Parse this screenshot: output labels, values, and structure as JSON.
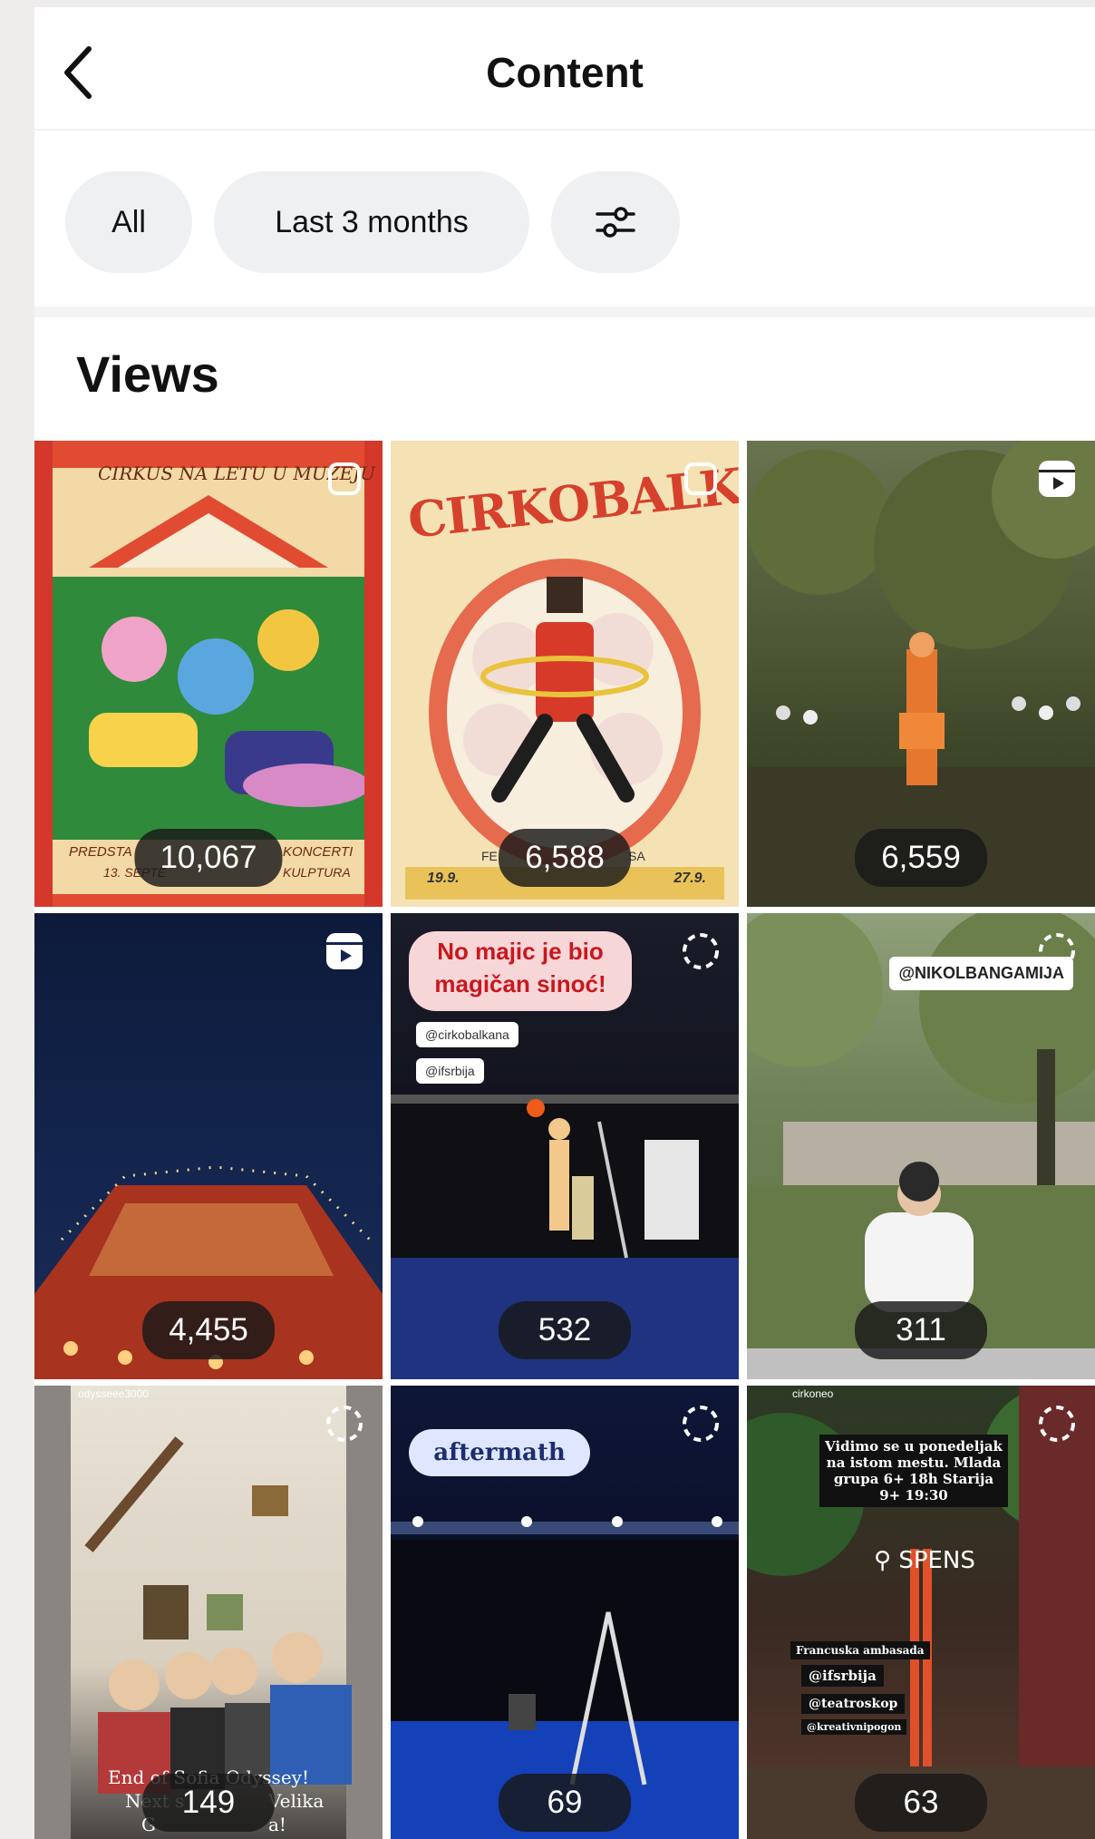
{
  "header": {
    "title": "Content"
  },
  "filters": {
    "all_label": "All",
    "range_label": "Last 3 months"
  },
  "section": {
    "title": "Views"
  },
  "colors": {
    "badge_bg": "#1c1c1c",
    "chip_bg": "#eef0f2",
    "accent_red": "#e14b32"
  },
  "tiles": [
    {
      "views": "10,067",
      "type_icon": "post-icon",
      "text1": "CIRKUS NA LETU U MUZEJU",
      "text2": "PREDSTA",
      "text3": "13. SEPTE",
      "text4": "KONCERTI",
      "text5": "KULPTURA"
    },
    {
      "views": "6,588",
      "type_icon": "post-icon",
      "text1": "CIRKOBALKANA",
      "text2": "19.9.",
      "text3": "27.9.",
      "text4": "FE",
      "text5": "SA"
    },
    {
      "views": "6,559",
      "type_icon": "reel-icon"
    },
    {
      "views": "4,455",
      "type_icon": "reel-icon"
    },
    {
      "views": "532",
      "type_icon": "story-icon",
      "text1": "No majic je bio magičan sinoć!",
      "text2": "@cirkobalkana",
      "text3": "@ifsrbija"
    },
    {
      "views": "311",
      "type_icon": "story-icon",
      "text1": "@NIKOLBANGAMIJA"
    },
    {
      "views": "149",
      "type_icon": "story-icon",
      "text1": "odysseee3000",
      "text2": "End of Sofia Odyssey!",
      "text3": "Next s",
      "text4": "Velika",
      "text5": "G",
      "text6": "a!"
    },
    {
      "views": "69",
      "type_icon": "story-icon",
      "text1": "aftermath"
    },
    {
      "views": "63",
      "type_icon": "story-icon",
      "text1": "cirkoneo",
      "text2": "Vidimo se u ponedeljak na istom mestu. Mlada grupa 6+ 18h Starija 9+ 19:30",
      "text3": "SPENS",
      "text4": "Francuska ambasada",
      "text5": "@ifsrbija",
      "text6": "@teatroskop",
      "text7": "@kreativnipogon"
    }
  ]
}
